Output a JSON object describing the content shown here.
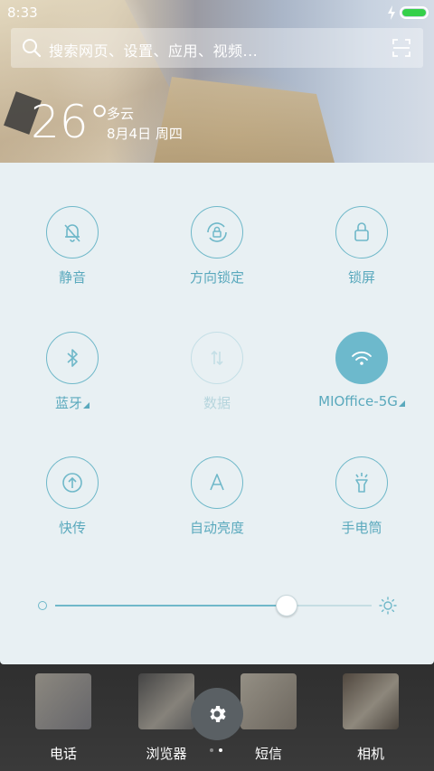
{
  "status_bar": {
    "time": "8:33",
    "battery_level": 1.0
  },
  "search": {
    "placeholder": "搜索网页、设置、应用、视频..."
  },
  "weather": {
    "temperature": "26°",
    "condition": "多云",
    "date": "8月4日 周四"
  },
  "quick_settings": [
    {
      "id": "mute",
      "label": "静音",
      "icon": "bell-off-icon",
      "state": "off"
    },
    {
      "id": "rotation-lock",
      "label": "方向锁定",
      "icon": "rotation-lock-icon",
      "state": "off"
    },
    {
      "id": "lock-screen",
      "label": "锁屏",
      "icon": "lock-icon",
      "state": "off"
    },
    {
      "id": "bluetooth",
      "label": "蓝牙",
      "icon": "bluetooth-icon",
      "state": "off",
      "has_more": true
    },
    {
      "id": "data",
      "label": "数据",
      "icon": "data-arrows-icon",
      "state": "disabled"
    },
    {
      "id": "wifi",
      "label": "MIOffice-5G",
      "icon": "wifi-icon",
      "state": "on",
      "has_more": true
    },
    {
      "id": "quick-share",
      "label": "快传",
      "icon": "upload-icon",
      "state": "off"
    },
    {
      "id": "auto-brightness",
      "label": "自动亮度",
      "icon": "auto-brightness-icon",
      "state": "off"
    },
    {
      "id": "flashlight",
      "label": "手电筒",
      "icon": "flashlight-icon",
      "state": "off"
    }
  ],
  "brightness": {
    "level": 0.73
  },
  "dock": {
    "apps": [
      {
        "label": "电话"
      },
      {
        "label": "浏览器"
      },
      {
        "label": "短信"
      },
      {
        "label": "相机"
      }
    ],
    "pages": {
      "count": 2,
      "current": 2
    }
  },
  "colors": {
    "accent": "#6db9cc",
    "panel_bg": "#e8f0f3",
    "label": "#5aa9bd",
    "battery": "#35d04a"
  }
}
